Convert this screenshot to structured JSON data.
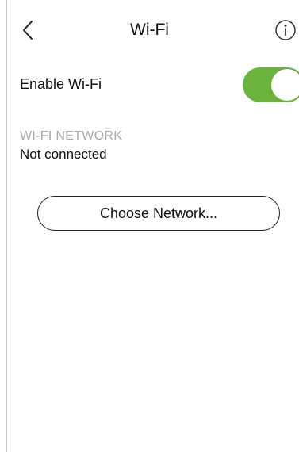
{
  "header": {
    "title": "Wi-Fi",
    "back_icon": "chevron-left-icon",
    "info_icon": "info-icon"
  },
  "wifi_toggle": {
    "label": "Enable Wi-Fi",
    "state": "on",
    "on_color": "#6bb33c"
  },
  "network": {
    "heading": "WI-FI NETWORK",
    "status": "Not connected"
  },
  "choose_button": {
    "label": "Choose Network..."
  }
}
